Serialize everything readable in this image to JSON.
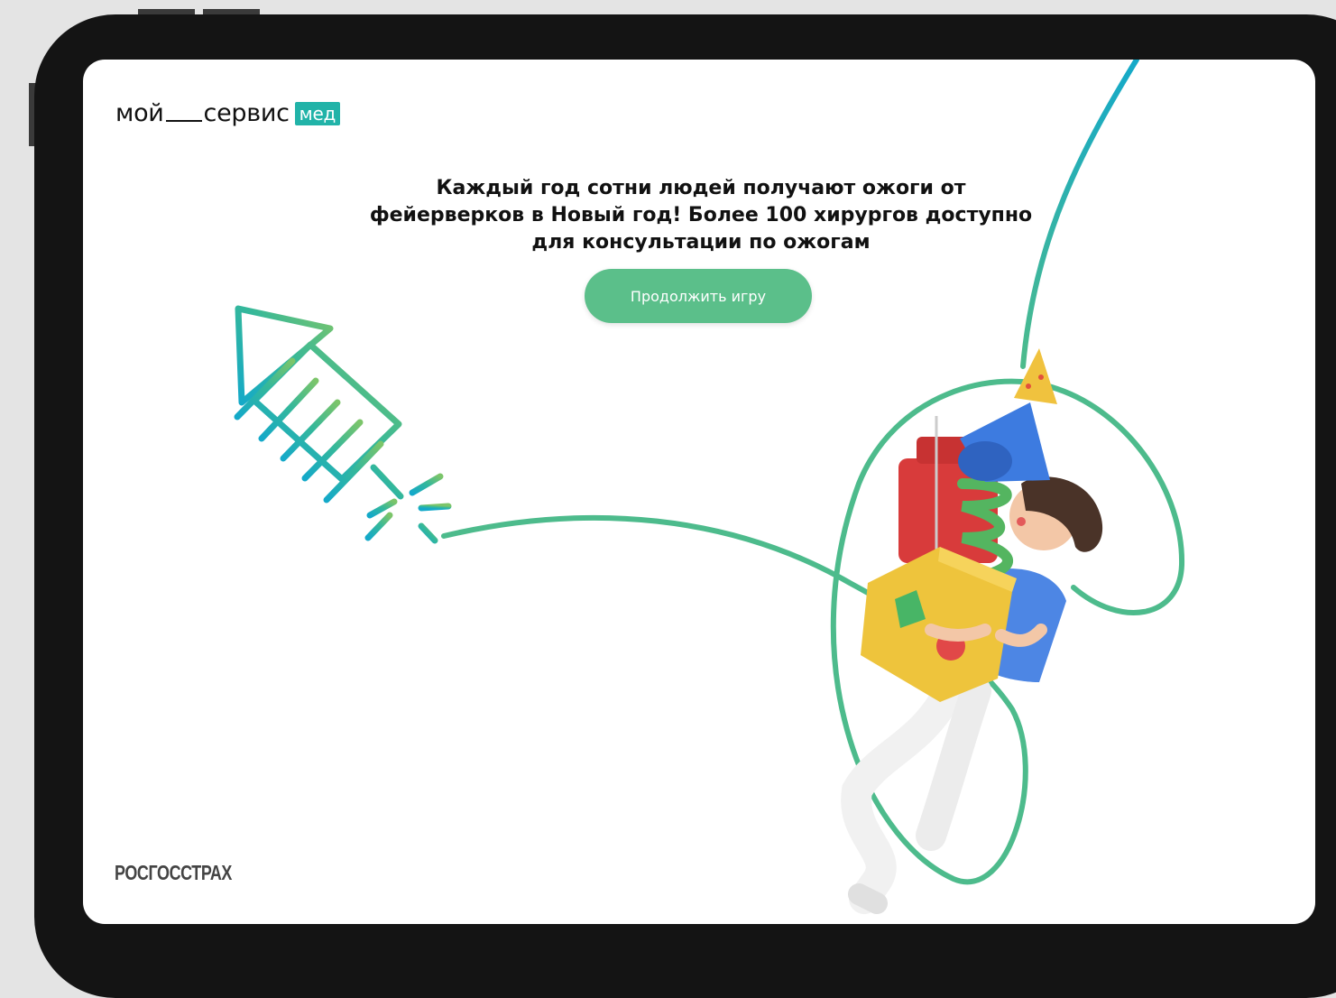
{
  "logo": {
    "part1": "мой",
    "part2": "сервис",
    "badge": "мед"
  },
  "headline": {
    "line1": "Каждый год сотни людей получают ожоги от",
    "line2": "фейерверков в Новый год! Более 100 хирургов доступно",
    "line3": "для консультации по ожогам"
  },
  "cta": {
    "label": "Продолжить игру"
  },
  "brand": {
    "label": "РОСГОССТРАХ"
  },
  "colors": {
    "accent": "#5bbf8a",
    "logo_badge": "#21b3a8",
    "line": "#4dbb8c",
    "tablet_frame": "#141414"
  },
  "illustration": {
    "rocket": "firework-rocket-icon",
    "person": "person-with-gift-box",
    "fuse": "fuse-line"
  }
}
